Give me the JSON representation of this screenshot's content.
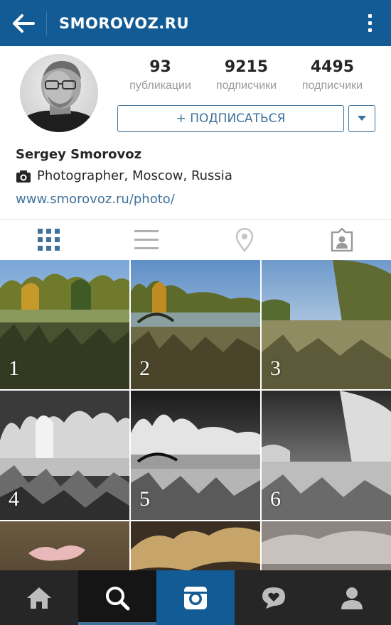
{
  "topbar": {
    "title": "SMOROVOZ.RU",
    "back_icon": "arrow-left-icon",
    "more_icon": "more-vertical-icon"
  },
  "profile": {
    "avatar_icon": "profile-photo",
    "stats": [
      {
        "value": "93",
        "label": "публикации"
      },
      {
        "value": "9215",
        "label": "подписчики"
      },
      {
        "value": "4495",
        "label": "подписчики"
      }
    ],
    "follow_label": "+ ПОДПИСАТЬСЯ",
    "name": "Sergey Smorovoz",
    "bio_icon": "camera-icon",
    "bio": "Photographer, Moscow, Russia",
    "website": "www.smorovoz.ru/photo/"
  },
  "tabs": [
    "grid-view-icon",
    "list-view-icon",
    "location-pin-icon",
    "tagged-photos-icon"
  ],
  "grid": {
    "numbers": [
      "1",
      "2",
      "3",
      "4",
      "5",
      "6"
    ]
  },
  "bottomnav": [
    "home-icon",
    "search-icon",
    "camera-icon",
    "activity-heart-icon",
    "profile-icon"
  ],
  "colors": {
    "brand_blue": "#135b94",
    "accent": "#3f729b",
    "nav_dark": "#262626"
  }
}
